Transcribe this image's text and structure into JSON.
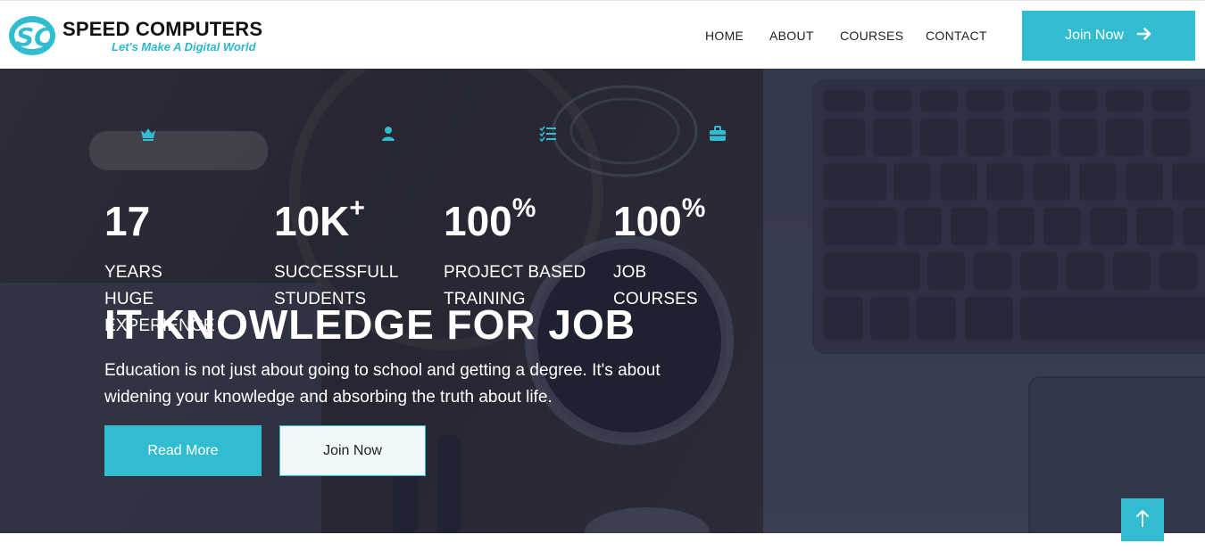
{
  "brand": {
    "name": "SPEED COMPUTERS",
    "tagline": "Let's Make A Digital World",
    "logo_text": "SC",
    "accent_color": "#31bdcf"
  },
  "nav": {
    "items": [
      "HOME",
      "ABOUT",
      "COURSES",
      "CONTACT"
    ],
    "cta_label": "Join Now",
    "cta_icon": "arrow-right-icon"
  },
  "stats": [
    {
      "icon": "crown-icon",
      "number": "17",
      "suffix": "",
      "label_lines": [
        "YEARS",
        "HUGE",
        "EXPERIENCE"
      ]
    },
    {
      "icon": "user-icon",
      "number": "10K",
      "suffix": "+",
      "label_lines": [
        "SUCCESSFULL",
        "STUDENTS"
      ]
    },
    {
      "icon": "list-check-icon",
      "number": "100",
      "suffix": "%",
      "label_lines": [
        "PROJECT BASED",
        "TRAINING"
      ]
    },
    {
      "icon": "briefcase-icon",
      "number": "100",
      "suffix": "%",
      "label_lines": [
        "JOB",
        "COURSES"
      ]
    }
  ],
  "hero": {
    "title": "IT KNOWLEDGE FOR JOB",
    "description": "Education is not just about going to school and getting a degree. It's about widening your knowledge and absorbing the truth about life.",
    "primary_button": "Read More",
    "secondary_button": "Join Now"
  },
  "scroll_top_icon": "arrow-up-icon"
}
